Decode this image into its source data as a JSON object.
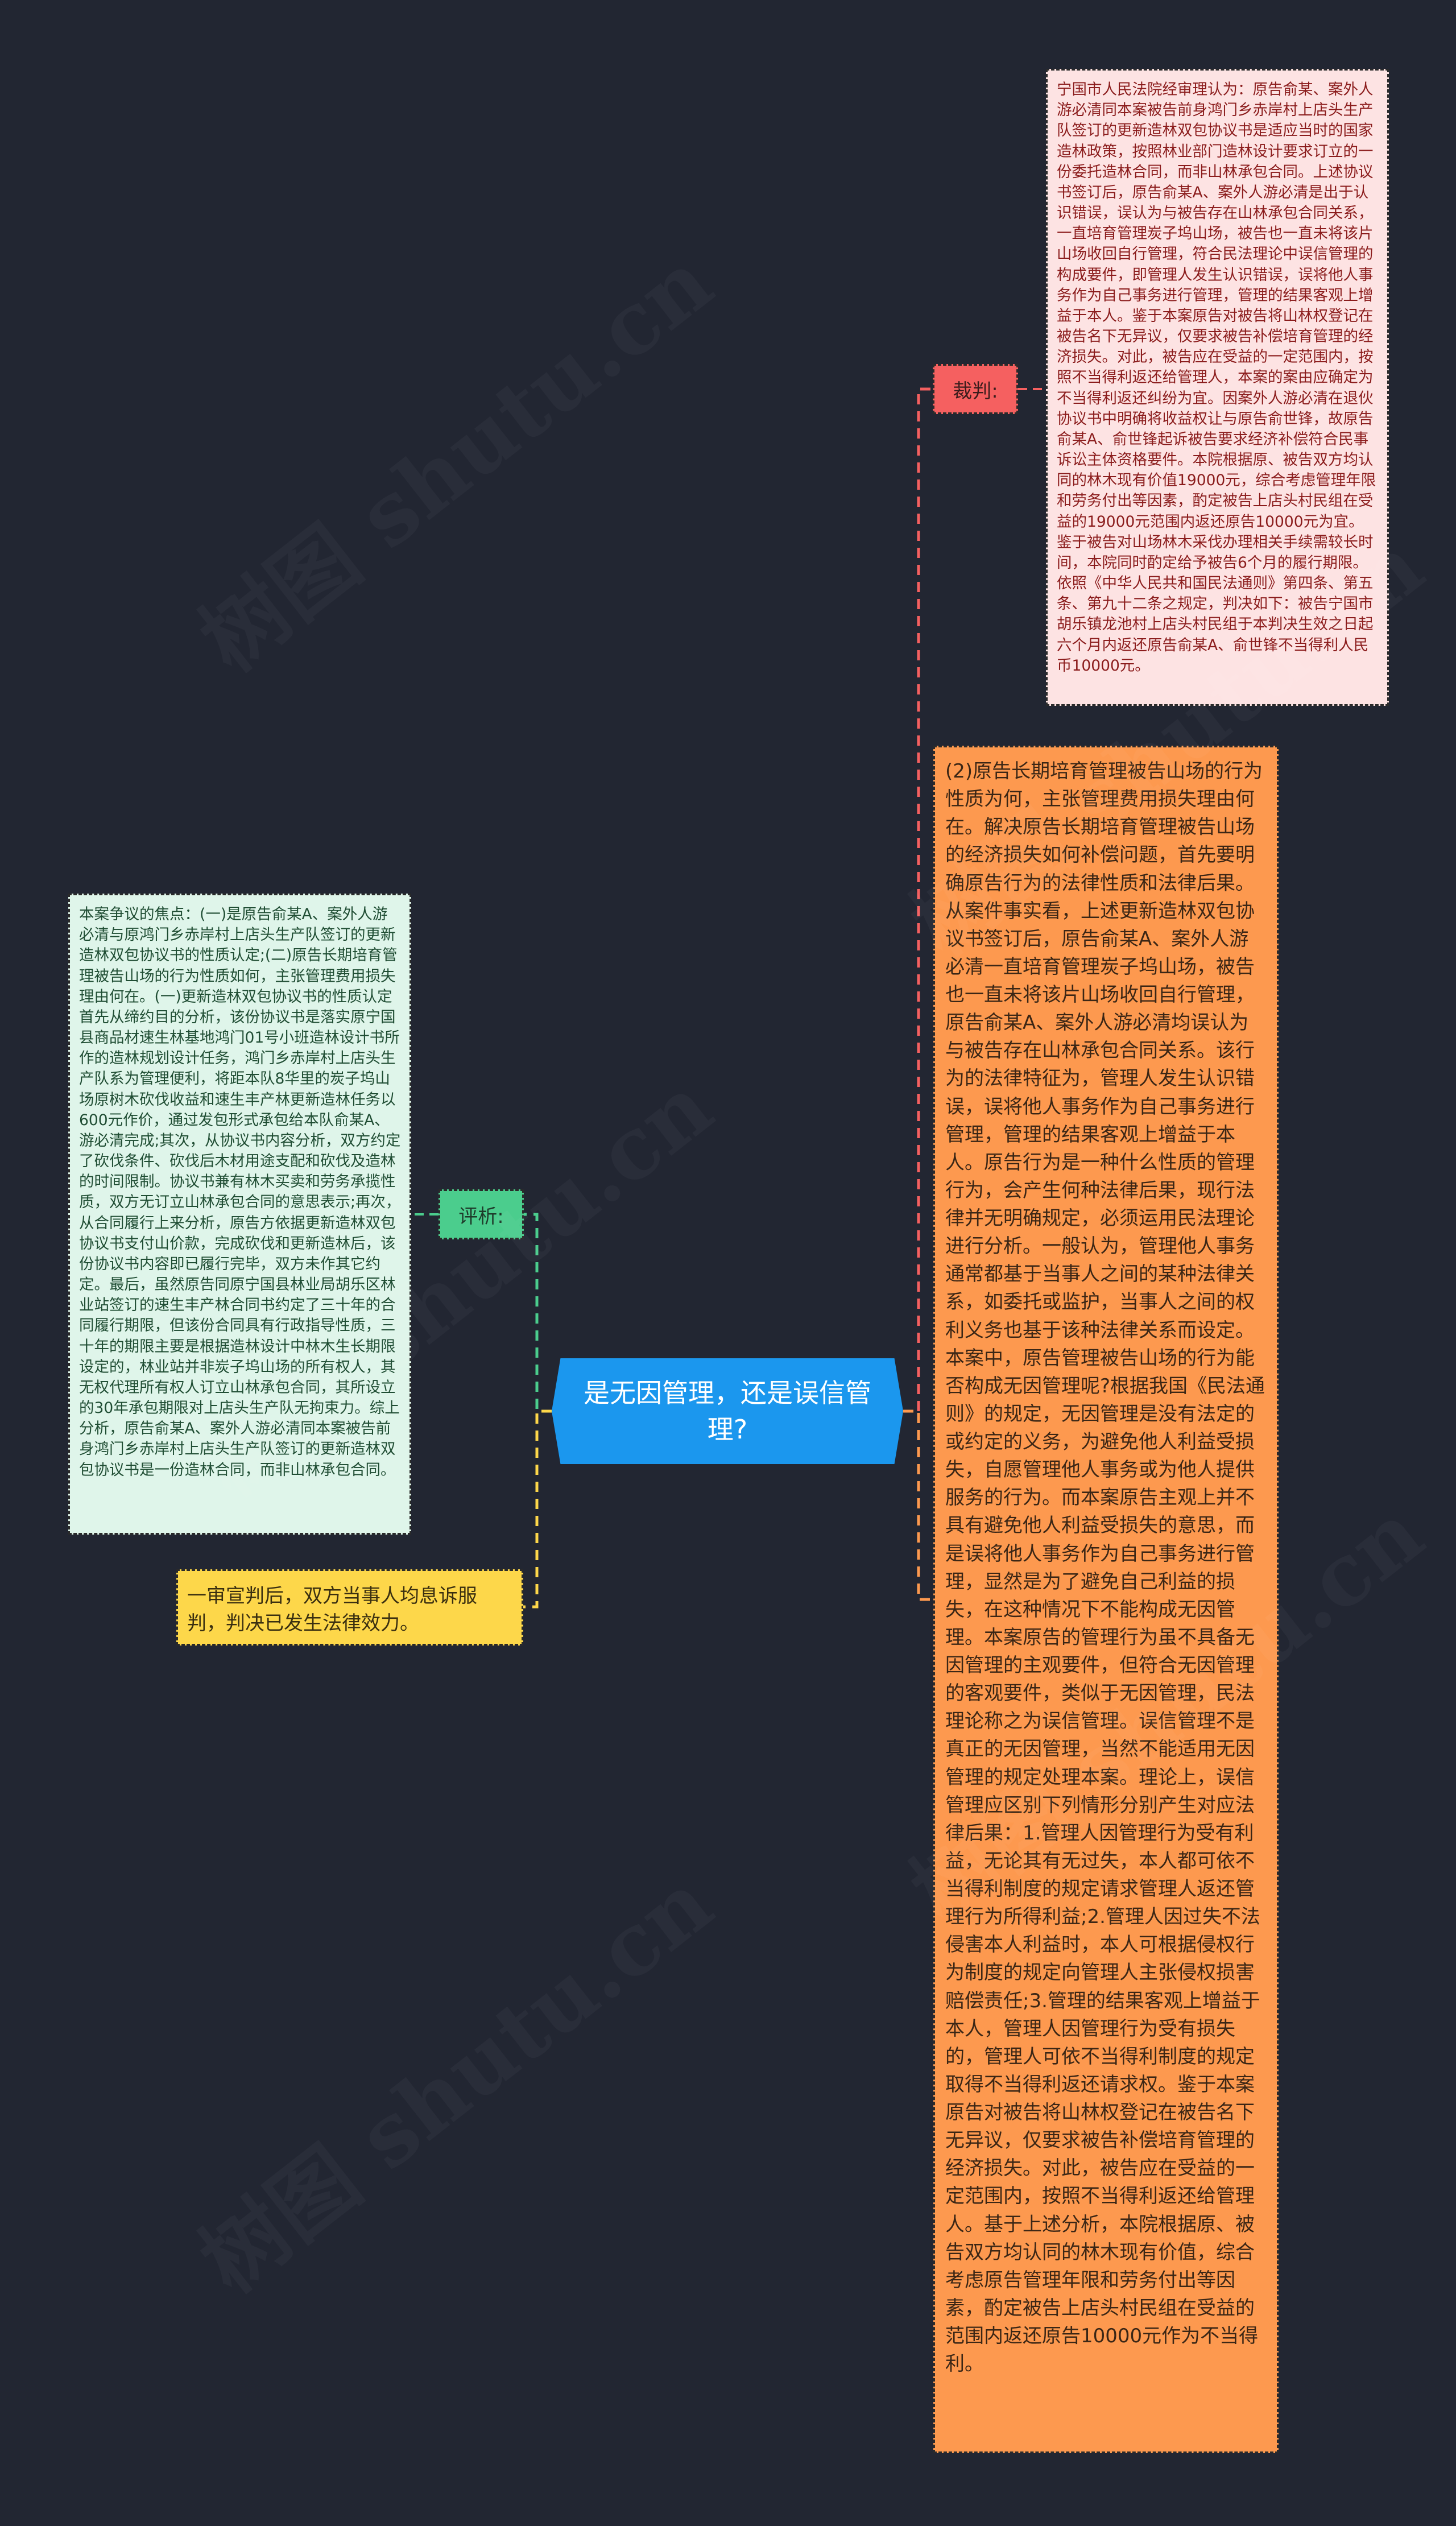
{
  "mindmap": {
    "central_topic": "是无因管理，还是误信管理?",
    "branches": {
      "verdict": {
        "label": "裁判:",
        "color": "#f56060",
        "content": "宁国市人民法院经审理认为：原告俞某、案外人游必清同本案被告前身鸿门乡赤岸村上店头生产队签订的更新造林双包协议书是适应当时的国家造林政策，按照林业部门造林设计要求订立的一份委托造林合同，而非山林承包合同。上述协议书签订后，原告俞某A、案外人游必清是出于认识错误，误认为与被告存在山林承包合同关系，一直培育管理炭子坞山场，被告也一直未将该片山场收回自行管理，符合民法理论中误信管理的构成要件，即管理人发生认识错误，误将他人事务作为自己事务进行管理，管理的结果客观上增益于本人。鉴于本案原告对被告将山林权登记在被告名下无异议，仅要求被告补偿培育管理的经济损失。对此，被告应在受益的一定范围内，按照不当得利返还给管理人，本案的案由应确定为不当得利返还纠纷为宜。因案外人游必清在退伙协议书中明确将收益权让与原告俞世锋，故原告俞某A、俞世锋起诉被告要求经济补偿符合民事诉讼主体资格要件。本院根据原、被告双方均认同的林木现有价值19000元，综合考虑管理年限和劳务付出等因素，酌定被告上店头村民组在受益的19000元范围内返还原告10000元为宜。鉴于被告对山场林木采伐办理相关手续需较长时间，本院同时酌定给予被告6个月的履行期限。依照《中华人民共和国民法通则》第四条、第五条、第九十二条之规定，判决如下：被告宁国市胡乐镇龙池村上店头村民组于本判决生效之日起六个月内返还原告俞某A、俞世锋不当得利人民币10000元。"
      },
      "analysis_2": {
        "color": "#fd994f",
        "content": "(2)原告长期培育管理被告山场的行为性质为何，主张管理费用损失理由何在。解决原告长期培育管理被告山场的经济损失如何补偿问题，首先要明确原告行为的法律性质和法律后果。从案件事实看，上述更新造林双包协议书签订后，原告俞某A、案外人游必清一直培育管理炭子坞山场，被告也一直未将该片山场收回自行管理，原告俞某A、案外人游必清均误认为与被告存在山林承包合同关系。该行为的法律特征为，管理人发生认识错误，误将他人事务作为自己事务进行管理，管理的结果客观上增益于本人。原告行为是一种什么性质的管理行为，会产生何种法律后果，现行法律并无明确规定，必须运用民法理论进行分析。一般认为，管理他人事务通常都基于当事人之间的某种法律关系，如委托或监护，当事人之间的权利义务也基于该种法律关系而设定。本案中，原告管理被告山场的行为能否构成无因管理呢?根据我国《民法通则》的规定，无因管理是没有法定的或约定的义务，为避免他人利益受损失，自愿管理他人事务或为他人提供服务的行为。而本案原告主观上并不具有避免他人利益受损失的意思，而是误将他人事务作为自己事务进行管理，显然是为了避免自己利益的损失，在这种情况下不能构成无因管理。本案原告的管理行为虽不具备无因管理的主观要件，但符合无因管理的客观要件，类似于无因管理，民法理论称之为误信管理。误信管理不是真正的无因管理，当然不能适用无因管理的规定处理本案。理论上，误信管理应区别下列情形分别产生对应法律后果：1.管理人因管理行为受有利益，无论其有无过失，本人都可依不当得利制度的规定请求管理人返还管理行为所得利益;2.管理人因过失不法侵害本人利益时，本人可根据侵权行为制度的规定向管理人主张侵权损害赔偿责任;3.管理的结果客观上增益于本人，管理人因管理行为受有损失的，管理人可依不当得利制度的规定取得不当得利返还请求权。鉴于本案原告对被告将山林权登记在被告名下无异议，仅要求被告补偿培育管理的经济损失。对此，被告应在受益的一定范围内，按照不当得利返还给管理人。基于上述分析，本院根据原、被告双方均认同的林木现有价值，综合考虑原告管理年限和劳务付出等因素，酌定被告上店头村民组在受益的范围内返还原告10000元作为不当得利。"
      },
      "commentary": {
        "label": "评析:",
        "color": "#4bcd8d",
        "content": "本案争议的焦点：(一)是原告俞某A、案外人游必清与原鸿门乡赤岸村上店头生产队签订的更新造林双包协议书的性质认定;(二)原告长期培育管理被告山场的行为性质如何，主张管理费用损失理由何在。(一)更新造林双包协议书的性质认定首先从缔约目的分析，该份协议书是落实原宁国县商品材速生林基地鸿门01号小班造林设计书所作的造林规划设计任务，鸿门乡赤岸村上店头生产队系为管理便利，将距本队8华里的炭子坞山场原树木砍伐收益和速生丰产林更新造林任务以600元作价，通过发包形式承包给本队俞某A、游必清完成;其次，从协议书内容分析，双方约定了砍伐条件、砍伐后木材用途支配和砍伐及造林的时间限制。协议书兼有林木买卖和劳务承揽性质，双方无订立山林承包合同的意思表示;再次，从合同履行上来分析，原告方依据更新造林双包协议书支付山价款，完成砍伐和更新造林后，该份协议书内容即已履行完毕，双方未作其它约定。最后，虽然原告同原宁国县林业局胡乐区林业站签订的速生丰产林合同书约定了三十年的合同履行期限，但该份合同具有行政指导性质，三十年的期限主要是根据造林设计中林木生长期限设定的，林业站并非炭子坞山场的所有权人，其无权代理所有权人订立山林承包合同，其所设立的30年承包期限对上店头生产队无拘束力。综上分析，原告俞某A、案外人游必清同本案被告前身鸿门乡赤岸村上店头生产队签订的更新造林双包协议书是一份造林合同，而非山林承包合同。"
      },
      "outcome": {
        "color": "#fdd74a",
        "content": "一审宣判后，双方当事人均息诉服判，判决已发生法律效力。"
      }
    },
    "colors": {
      "background": "#222632",
      "central": "#1b97ee",
      "connector_verdict": "#f56060",
      "connector_orange": "#fd994f",
      "connector_commentary": "#4bcd8d",
      "connector_outcome": "#fdd74a"
    }
  },
  "watermark": "树图 shutu.cn"
}
